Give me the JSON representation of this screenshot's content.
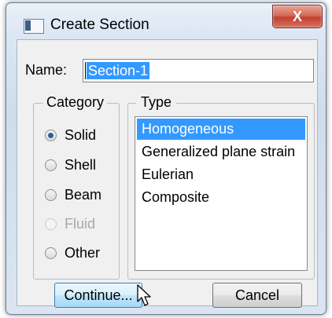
{
  "window": {
    "title": "Create Section",
    "close_glyph": "X"
  },
  "name": {
    "label": "Name:",
    "value": "Section-1"
  },
  "category": {
    "legend": "Category",
    "options": [
      {
        "label": "Solid",
        "checked": true,
        "disabled": false
      },
      {
        "label": "Shell",
        "checked": false,
        "disabled": false
      },
      {
        "label": "Beam",
        "checked": false,
        "disabled": false
      },
      {
        "label": "Fluid",
        "checked": false,
        "disabled": true
      },
      {
        "label": "Other",
        "checked": false,
        "disabled": false
      }
    ]
  },
  "type": {
    "legend": "Type",
    "items": [
      {
        "label": "Homogeneous",
        "selected": true
      },
      {
        "label": "Generalized plane strain",
        "selected": false
      },
      {
        "label": "Eulerian",
        "selected": false
      },
      {
        "label": "Composite",
        "selected": false
      }
    ]
  },
  "buttons": {
    "continue_label": "Continue...",
    "cancel_label": "Cancel"
  },
  "colors": {
    "selection": "#3399ff",
    "close_button": "#c2402f"
  },
  "icons": {
    "window": "window-icon",
    "cursor": "mouse-cursor-icon"
  }
}
